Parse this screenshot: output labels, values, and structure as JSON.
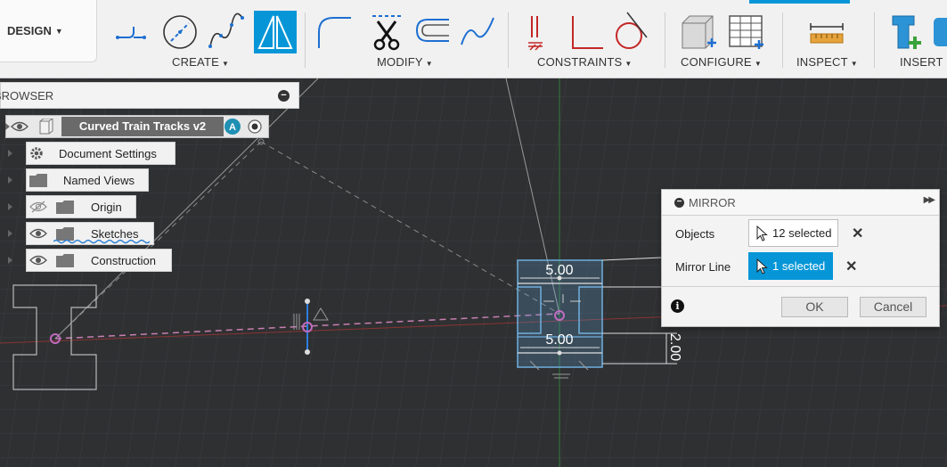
{
  "toolbar": {
    "workspace_label": "DESIGN",
    "groups": {
      "create": "CREATE",
      "modify": "MODIFY",
      "constraints": "CONSTRAINTS",
      "configure": "CONFIGURE",
      "inspect": "INSPECT",
      "insert": "INSERT"
    },
    "accent_color": "#0696d7"
  },
  "browser": {
    "title": "BROWSER",
    "root_label": "Curved Train Tracks v2",
    "items": [
      {
        "label": "Document Settings",
        "icon": "gear-icon"
      },
      {
        "label": "Named Views",
        "icon": "folder-icon"
      },
      {
        "label": "Origin",
        "icon": "folder-icon",
        "visibility": "hidden"
      },
      {
        "label": "Sketches",
        "icon": "folder-icon",
        "visibility": "visible"
      },
      {
        "label": "Construction",
        "icon": "folder-icon",
        "visibility": "visible"
      }
    ]
  },
  "mirror": {
    "title": "MIRROR",
    "objects_label": "Objects",
    "objects_value": "12 selected",
    "mirror_line_label": "Mirror Line",
    "mirror_line_value": "1 selected",
    "ok_label": "OK",
    "cancel_label": "Cancel"
  },
  "sketch": {
    "dimension_top": "5.00",
    "dimension_bottom": "5.00",
    "dimension_side": "2.00"
  }
}
